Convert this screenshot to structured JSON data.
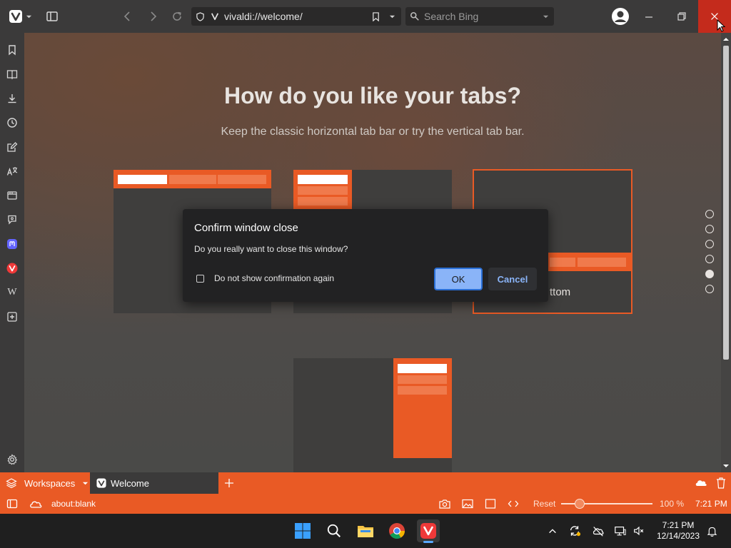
{
  "browser": {
    "url": "vivaldi://welcome/",
    "search_placeholder": "Search Bing"
  },
  "welcome": {
    "heading": "How do you like your tabs?",
    "subheading": "Keep the classic horizontal tab bar or try the vertical tab bar.",
    "bottom_option_label": "ttom",
    "page_dots": 6,
    "active_dot": 4
  },
  "dialog": {
    "title": "Confirm window close",
    "message": "Do you really want to close this window?",
    "checkbox_label": "Do not show confirmation again",
    "ok_label": "OK",
    "cancel_label": "Cancel"
  },
  "tabstrip": {
    "workspaces_label": "Workspaces",
    "active_tab_title": "Welcome"
  },
  "statusbar": {
    "url": "about:blank",
    "reset_label": "Reset",
    "zoom": "100 %",
    "time": "7:21 PM"
  },
  "taskbar": {
    "time": "7:21 PM",
    "date": "12/14/2023"
  },
  "colors": {
    "accent": "#e95a25",
    "dialog_ok": "#8ab4f8",
    "close_hover": "#c42b1c"
  }
}
